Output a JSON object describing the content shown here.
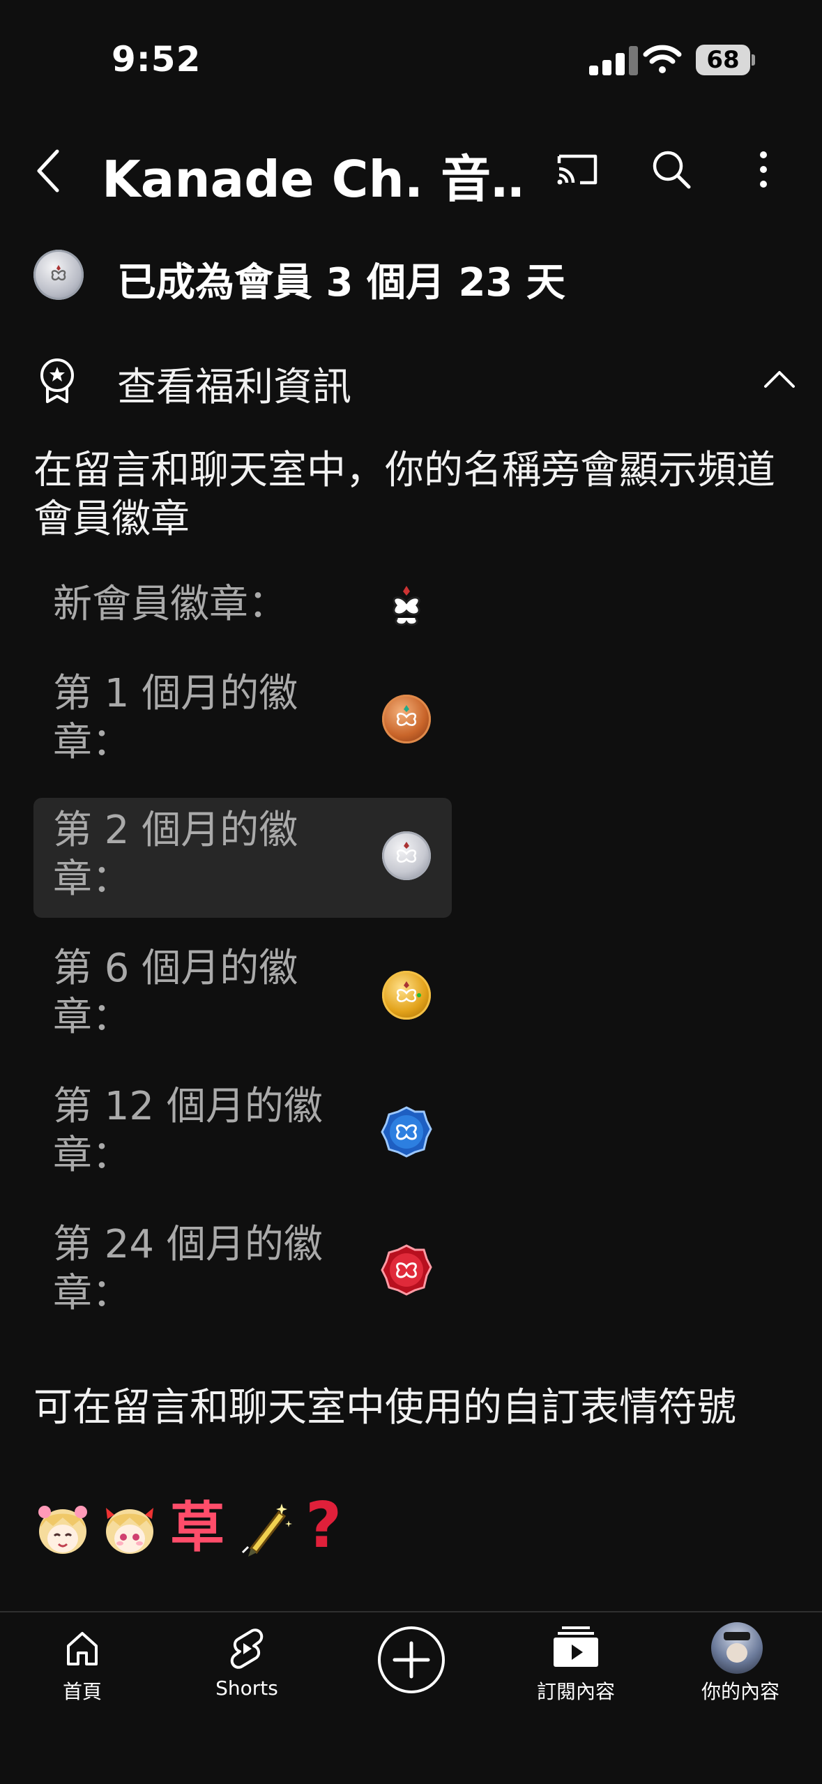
{
  "status_bar": {
    "time": "9:52",
    "battery": "68"
  },
  "header": {
    "title": "Kanade Ch. 音…"
  },
  "membership": {
    "duration_text": "已成為會員 3 個月 23 天"
  },
  "perks": {
    "toggle_label": "查看福利資訊",
    "badge_description": "在留言和聊天室中，你的名稱旁會顯示頻道會員徽章",
    "badges": [
      {
        "label": "新會員徽章：",
        "color": "#ffffff"
      },
      {
        "label": "第 1 個月的徽章：",
        "color": "#c9652a"
      },
      {
        "label": "第 2 個月的徽章：",
        "color": "#c7c9d1"
      },
      {
        "label": "第 6 個月的徽章：",
        "color": "#e2a21a"
      },
      {
        "label": "第 12 個月的徽章：",
        "color": "#2d7fe0"
      },
      {
        "label": "第 24 個月的徽章：",
        "color": "#e02a3a"
      }
    ],
    "emoji_title": "可在留言和聊天室中使用的自訂表情符號",
    "emojis": [
      "chibi-girl-smile",
      "chibi-girl-blush",
      "草",
      "pen-sparkle",
      "?"
    ]
  },
  "bottom_nav": {
    "items": [
      {
        "label": "首頁",
        "icon": "home-icon"
      },
      {
        "label": "Shorts",
        "icon": "shorts-icon"
      },
      {
        "label": "",
        "icon": "create-icon"
      },
      {
        "label": "訂閱內容",
        "icon": "subscriptions-icon"
      },
      {
        "label": "你的內容",
        "icon": "avatar"
      }
    ]
  }
}
